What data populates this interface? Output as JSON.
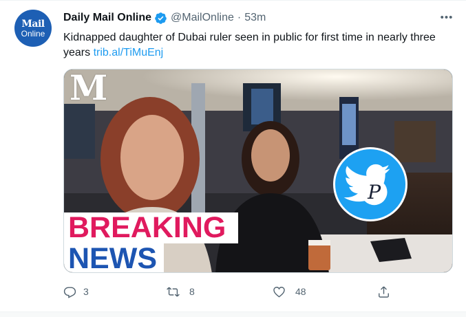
{
  "tweet": {
    "avatar": {
      "line1": "Mail",
      "line2": "Online"
    },
    "display_name": "Daily Mail Online",
    "handle": "@MailOnline",
    "separator": "·",
    "time": "53m",
    "more_label": "•••",
    "text": "Kidnapped daughter of Dubai ruler seen in public for first time in nearly three years ",
    "link": "trib.al/TiMuEnj",
    "media": {
      "watermark": "M",
      "banner_line1": "BREAKING",
      "banner_line2": "NEWS",
      "bird_letter": "P"
    },
    "actions": {
      "replies": "3",
      "retweets": "8",
      "likes": "48"
    }
  },
  "colors": {
    "accent": "#1d9bf0",
    "avatar_bg": "#1d5fb4",
    "breaking": "#e01a5e",
    "news": "#1d55b2",
    "muted": "#536471"
  }
}
